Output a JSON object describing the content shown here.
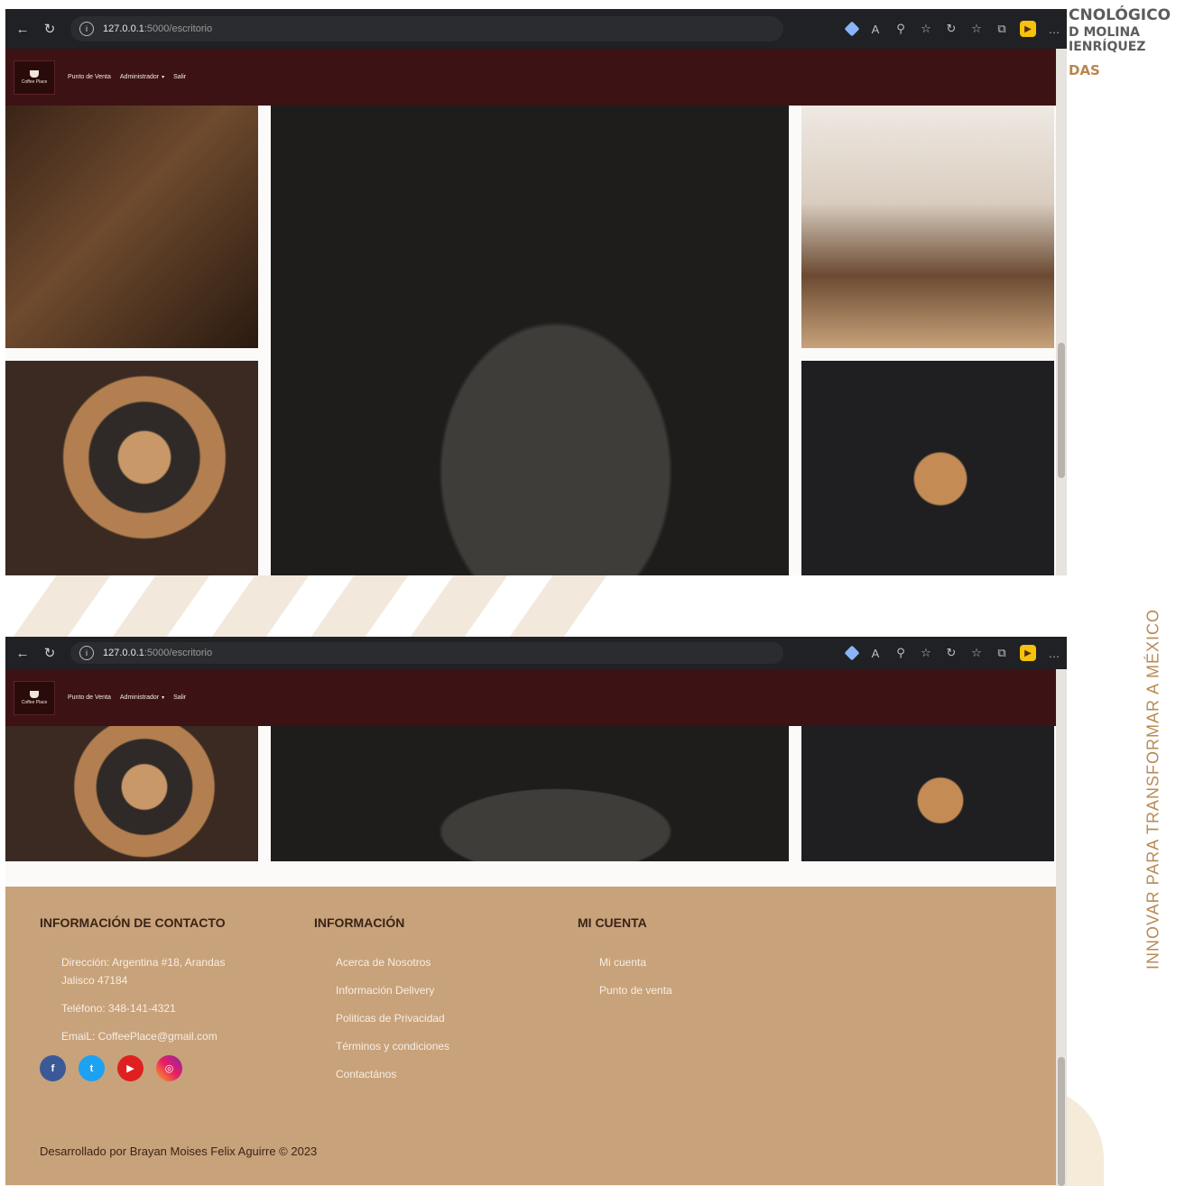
{
  "slide": {
    "brand_line1": "CNOLÓGICO",
    "brand_line2": "D MOLINA",
    "brand_line3": "IENRÍQUEZ",
    "brand_line4": "DAS",
    "vertical_slogan": "INNOVAR PARA TRANSFORMAR A MÉXICO"
  },
  "browser": {
    "url_host": "127.0.0.1",
    "url_path": ":5000/escritorio",
    "info_icon": "info-icon"
  },
  "navbar": {
    "logo_text": "Coffee Place",
    "links": [
      "Punto de Venta",
      "Administrador",
      "Salir"
    ]
  },
  "footer": {
    "contact": {
      "title": "INFORMACIÓN DE CONTACTO",
      "address": "Dirección: Argentina #18, Arandas Jalisco 47184",
      "phone": "Teléfono: 348-141-4321",
      "email": "EmaiL: CoffeePlace@gmail.com"
    },
    "info": {
      "title": "INFORMACIÓN",
      "links": [
        "Acerca de Nosotros",
        "Información Delivery",
        "Politicas de Privacidad",
        "Términos y condiciones",
        "Contactános"
      ]
    },
    "account": {
      "title": "MI CUENTA",
      "links": [
        "Mi cuenta",
        "Punto de venta"
      ]
    },
    "social": [
      "f",
      "t",
      "▶",
      "◎"
    ],
    "copyright": "Desarrollado por Brayan Moises Felix Aguirre © 2023"
  },
  "colors": {
    "navbar": "#3d1214",
    "footer": "#c8a27a",
    "footer_heading": "#3a2417"
  }
}
